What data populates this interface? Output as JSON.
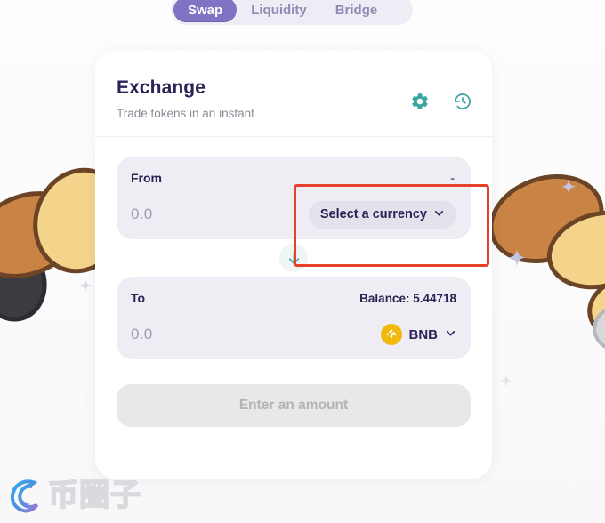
{
  "nav": {
    "tabs": [
      {
        "label": "Swap",
        "active": true,
        "name": "tab-swap"
      },
      {
        "label": "Liquidity",
        "active": false,
        "name": "tab-liquidity"
      },
      {
        "label": "Bridge",
        "active": false,
        "name": "tab-bridge"
      }
    ]
  },
  "card": {
    "title": "Exchange",
    "subtitle": "Trade tokens in an instant",
    "actions": [
      {
        "icon": "gear-icon",
        "label": "Settings"
      },
      {
        "icon": "history-icon",
        "label": "Recent transactions"
      }
    ]
  },
  "from": {
    "label": "From",
    "right_meta": "-",
    "amount_value": "0.0",
    "amount_placeholder": "0.0",
    "currency_button": "Select a currency",
    "chevron": "chevron-down-icon"
  },
  "swap_button": {
    "icon": "arrow-down-icon",
    "label": "Switch tokens"
  },
  "to": {
    "label": "To",
    "balance": "Balance: 5.44718",
    "amount_value": "0.0",
    "amount_placeholder": "0.0",
    "token_symbol": "BNB",
    "token_logo": "bnb-logo-icon",
    "chevron": "chevron-down-icon"
  },
  "cta": {
    "label": "Enter an amount",
    "disabled": true
  },
  "annotation": {
    "type": "rectangle-highlight",
    "target": "from-currency-select-area",
    "color": "#e8402a"
  },
  "watermark": {
    "text": "币圈子"
  },
  "colors": {
    "brand_purple": "#7f74c4",
    "title_navy": "#2b2255",
    "teal_icon": "#3aa6a2",
    "panel_grey": "#eeedf3",
    "bnb_yellow": "#f0b90b",
    "annotation_red": "#e8402a",
    "cta_disabled_bg": "#e8e8e8"
  }
}
